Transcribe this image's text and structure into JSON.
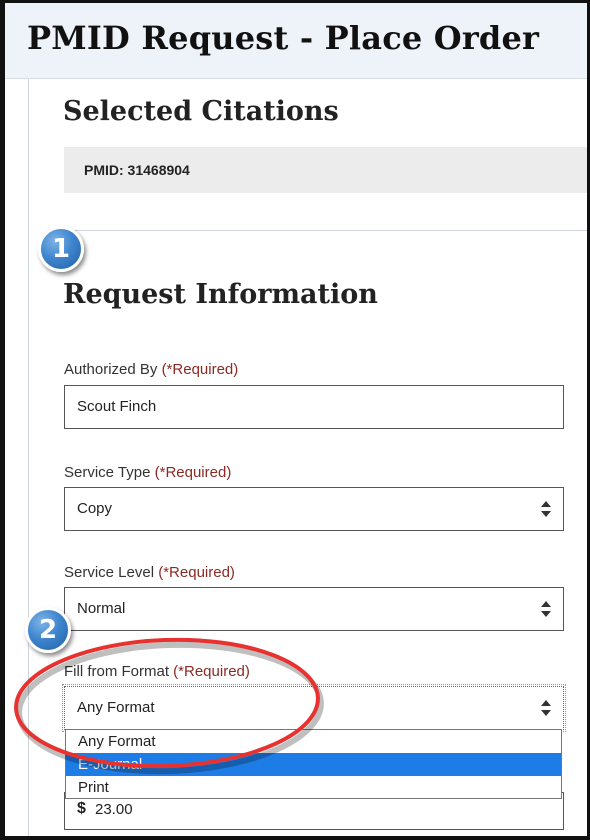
{
  "page": {
    "title": "PMID Request - Place Order"
  },
  "selected_citations": {
    "heading": "Selected Citations",
    "items": [
      {
        "label": "PMID: 31468904"
      }
    ]
  },
  "request_information": {
    "step_number": "1",
    "heading": "Request Information",
    "required_marker": "(*Required)",
    "authorized_by": {
      "label": "Authorized By",
      "value": "Scout Finch"
    },
    "service_type": {
      "label": "Service Type",
      "value": "Copy"
    },
    "service_level": {
      "label": "Service Level",
      "value": "Normal"
    },
    "fill_from_format": {
      "step_number": "2",
      "label": "Fill from Format",
      "value": "Any Format",
      "options": [
        "Any Format",
        "E-Journal",
        "Print"
      ],
      "highlighted_option": "E-Journal"
    },
    "amount": {
      "currency_symbol": "$",
      "value": "23.00"
    }
  },
  "colors": {
    "header_background": "#eef3f9",
    "required_text": "#8b2a24",
    "dropdown_highlight": "#1e7ce6",
    "badge_blue": "#3f86cf",
    "annotation_red": "#e8322f"
  },
  "icons": {
    "select_arrows": "up-down-chevron-icon"
  }
}
